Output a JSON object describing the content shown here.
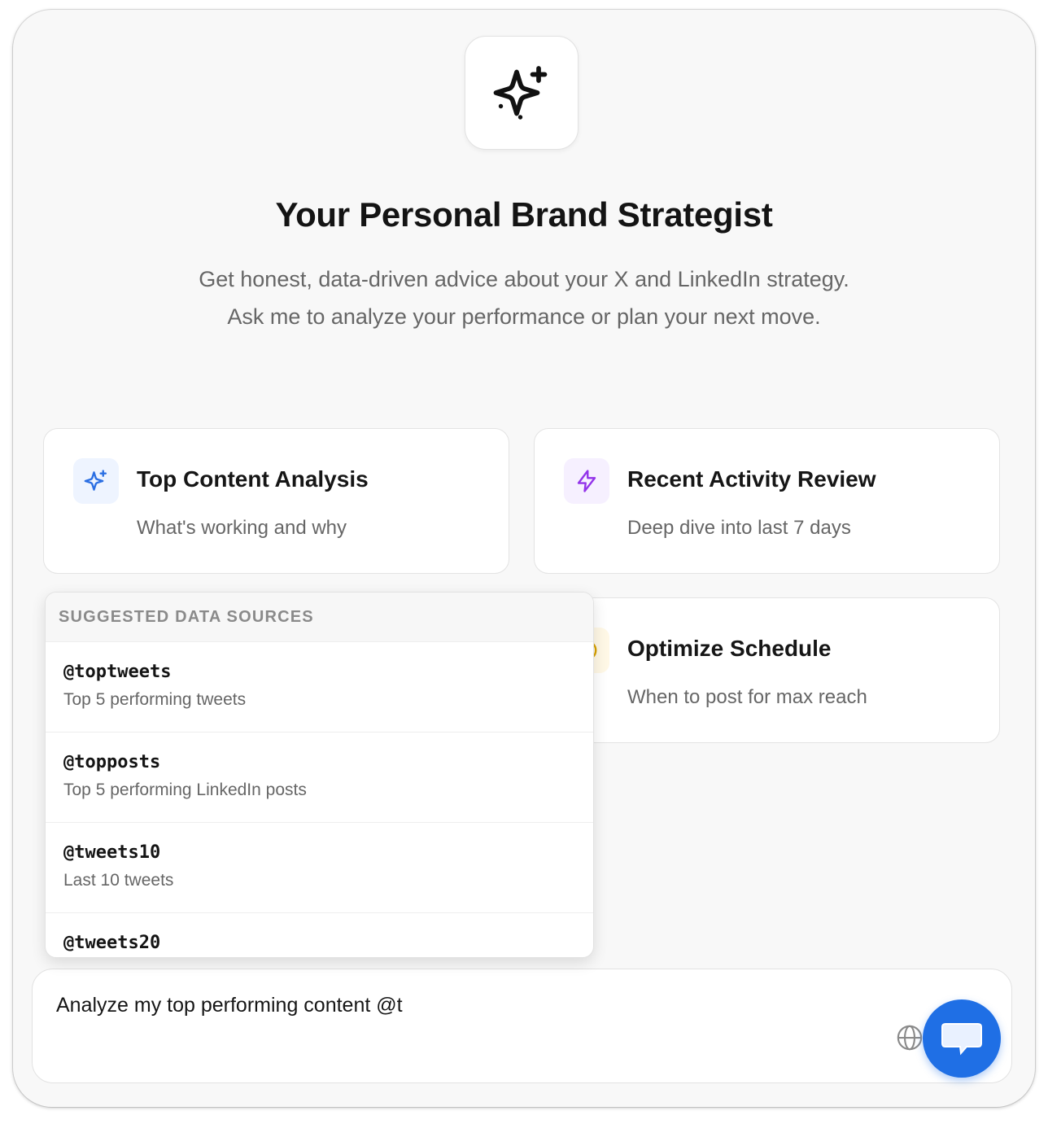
{
  "hero": {
    "icon": "sparkles-icon",
    "title": "Your Personal Brand Strategist",
    "subtitle": "Get honest, data-driven advice about your X and LinkedIn strategy. Ask me to analyze your performance or plan your next move."
  },
  "cards": [
    {
      "title": "Top Content Analysis",
      "description": "What's working and why",
      "icon": "sparkles-icon",
      "icon_color": "#2b6fe3",
      "icon_bg": "#eef4ff"
    },
    {
      "title": "Recent Activity Review",
      "description": "Deep dive into last 7 days",
      "icon": "lightning-icon",
      "icon_color": "#9333ea",
      "icon_bg": "#f6f0ff"
    },
    {
      "title": "Optimize Schedule",
      "description": "When to post for max reach",
      "icon": "clock-icon",
      "icon_color": "#d9a200",
      "icon_bg": "#fff8e6"
    }
  ],
  "suggestions": {
    "header": "SUGGESTED DATA SOURCES",
    "items": [
      {
        "command": "@toptweets",
        "description": "Top 5 performing tweets"
      },
      {
        "command": "@topposts",
        "description": "Top 5 performing LinkedIn posts"
      },
      {
        "command": "@tweets10",
        "description": "Last 10 tweets"
      },
      {
        "command": "@tweets20",
        "description": ""
      }
    ]
  },
  "composer": {
    "value": "Analyze my top performing content @t",
    "globe_icon": "globe-icon",
    "send_icon": "send-message-icon",
    "accent": "#1f6fe5"
  }
}
